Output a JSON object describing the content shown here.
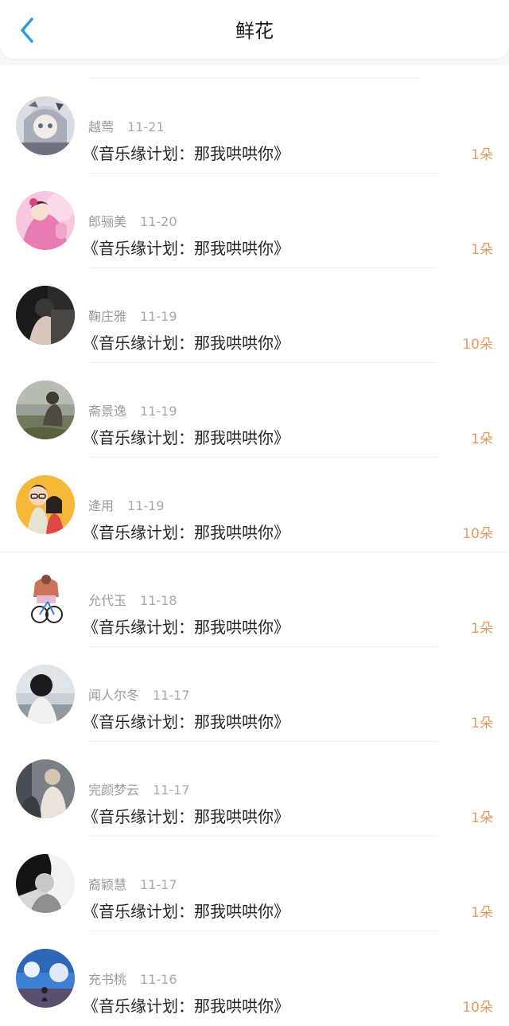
{
  "header": {
    "title": "鲜花"
  },
  "colors": {
    "accent": "#2b9ae8",
    "count": "#e59a5f",
    "muted_text": "#9a9a9a"
  },
  "items": [
    {
      "name": "越莺",
      "date": "11-21",
      "song": "《音乐缘计划：那我哄哄你》",
      "count": "1朵",
      "avatar": "anime-portrait"
    },
    {
      "name": "郎骊美",
      "date": "11-20",
      "song": "《音乐缘计划：那我哄哄你》",
      "count": "1朵",
      "avatar": "pink-illustration"
    },
    {
      "name": "鞠庄雅",
      "date": "11-19",
      "song": "《音乐缘计划：那我哄哄你》",
      "count": "10朵",
      "avatar": "dark-portrait"
    },
    {
      "name": "斋景逸",
      "date": "11-19",
      "song": "《音乐缘计划：那我哄哄你》",
      "count": "1朵",
      "avatar": "field-photo"
    },
    {
      "name": "逄用",
      "date": "11-19",
      "song": "《音乐缘计划：那我哄哄你》",
      "count": "10朵",
      "avatar": "cartoon-couple"
    },
    {
      "name": "允代玉",
      "date": "11-18",
      "song": "《音乐缘计划：那我哄哄你》",
      "count": "1朵",
      "avatar": "bike-figure"
    },
    {
      "name": "闻人尔冬",
      "date": "11-17",
      "song": "《音乐缘计划：那我哄哄你》",
      "count": "1朵",
      "avatar": "seaside-photo"
    },
    {
      "name": "完颜梦云",
      "date": "11-17",
      "song": "《音乐缘计划：那我哄哄你》",
      "count": "1朵",
      "avatar": "street-photo"
    },
    {
      "name": "裔颖慧",
      "date": "11-17",
      "song": "《音乐缘计划：那我哄哄你》",
      "count": "1朵",
      "avatar": "monochrome-portrait"
    },
    {
      "name": "充书桃",
      "date": "11-16",
      "song": "《音乐缘计划：那我哄哄你》",
      "count": "10朵",
      "avatar": "sky-photo"
    }
  ]
}
